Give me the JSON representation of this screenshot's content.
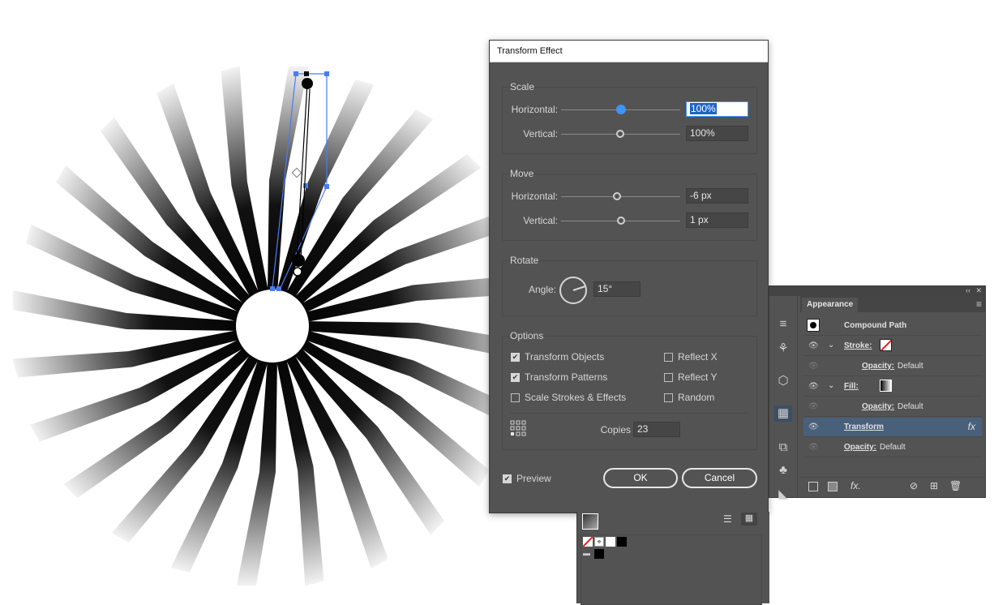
{
  "dialog": {
    "title": "Transform Effect",
    "scale": {
      "title": "Scale",
      "horizontal_label": "Horizontal:",
      "horizontal_value": "100%",
      "vertical_label": "Vertical:",
      "vertical_value": "100%"
    },
    "move": {
      "title": "Move",
      "horizontal_label": "Horizontal:",
      "horizontal_value": "-6 px",
      "vertical_label": "Vertical:",
      "vertical_value": "1 px"
    },
    "rotate": {
      "title": "Rotate",
      "angle_label": "Angle:",
      "angle_value": "15°"
    },
    "options": {
      "title": "Options",
      "transform_objects": "Transform Objects",
      "transform_patterns": "Transform Patterns",
      "scale_strokes": "Scale Strokes & Effects",
      "reflect_x": "Reflect X",
      "reflect_y": "Reflect Y",
      "random": "Random",
      "copies_label": "Copies",
      "copies_value": "23"
    },
    "preview_label": "Preview",
    "ok_label": "OK",
    "cancel_label": "Cancel"
  },
  "appearance": {
    "tab": "Appearance",
    "object_type": "Compound Path",
    "stroke_label": "Stroke:",
    "opacity_label": "Opacity:",
    "opacity_value": "Default",
    "fill_label": "Fill:",
    "transform_label": "Transform",
    "fx_label": "fx",
    "footer_fx": "fx."
  },
  "colors": {
    "panel_bg": "#535353",
    "accent_blue": "#3d95f5",
    "selection_row": "#49607b"
  },
  "icons": [
    "eye-icon",
    "chevron-down-icon",
    "hamburger-menu-icon",
    "reference-point-icon",
    "delete-icon",
    "new-item-icon",
    "clear-icon"
  ]
}
